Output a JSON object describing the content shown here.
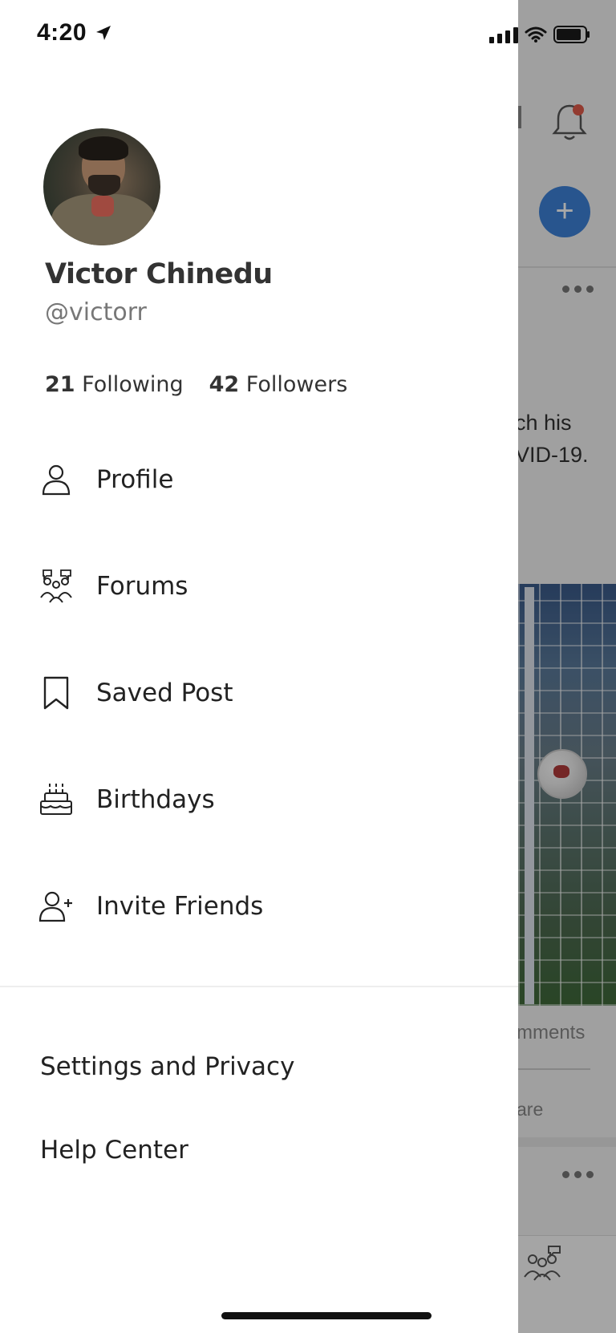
{
  "status_bar": {
    "time": "4:20",
    "icons": [
      "location-arrow-icon",
      "signal-icon",
      "wifi-icon",
      "battery-icon"
    ]
  },
  "drawer": {
    "user": {
      "name": "Victor Chinedu",
      "handle": "@victorr",
      "following_count": "21",
      "following_label": "Following",
      "followers_count": "42",
      "followers_label": "Followers"
    },
    "menu": [
      {
        "label": "Profile",
        "icon": "person-icon"
      },
      {
        "label": "Forums",
        "icon": "forums-icon"
      },
      {
        "label": "Saved Post",
        "icon": "bookmark-icon"
      },
      {
        "label": "Birthdays",
        "icon": "cake-icon"
      },
      {
        "label": "Invite Friends",
        "icon": "add-person-icon"
      }
    ],
    "settings_label": "Settings and Privacy",
    "help_label": "Help Center"
  },
  "background_feed": {
    "post_text_line1": "ch his",
    "post_text_line2": "VID-19.",
    "comments_label": "mments",
    "share_label": "are",
    "notification_dot_color": "#e05a4a",
    "add_button_color": "#3d82d8",
    "add_button_glyph": "+"
  }
}
